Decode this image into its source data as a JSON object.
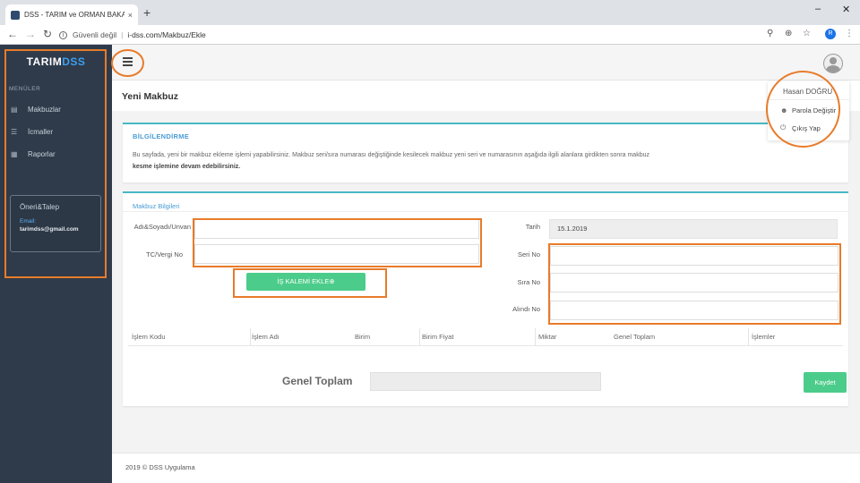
{
  "browser": {
    "tab_title": "DSS - TARIM ve ORMAN BAKAN",
    "tab_close": "×",
    "new_tab": "+",
    "security_label": "Güvenli değil",
    "url": "i-dss.com/Makbuz/Ekle",
    "profile_initial": "R"
  },
  "sidebar": {
    "brand_part1": "TARIM",
    "brand_part2": "DSS",
    "menu_header": "MENÜLER",
    "items": [
      {
        "label": "Makbuzlar",
        "icon": "receipt-icon"
      },
      {
        "label": "İcmaller",
        "icon": "list-icon"
      },
      {
        "label": "Raporlar",
        "icon": "grid-icon"
      }
    ],
    "feedback": {
      "title": "Öneri&Talep",
      "email_label": "Email:",
      "email": "tarimdss@gmail.com"
    }
  },
  "header": {
    "page_title": "Yeni Makbuz",
    "user_menu": {
      "name": "Hasan DOĞRU",
      "items": [
        {
          "label": "Parola Değiştir",
          "icon": "user-icon"
        },
        {
          "label": "Çıkış Yap",
          "icon": "power-icon"
        }
      ]
    }
  },
  "info": {
    "heading": "BİLGİLENDİRME",
    "text": "Bu sayfada, yeni bir makbuz ekleme işlemi yapabilirsiniz. Makbuz seri/sıra numarası değiştiğinde kesilecek makbuz yeni seri ve numarasının aşağıda ilgili alanlara girdikten sonra makbuz",
    "text_bold": "kesme işlemine devam edebilirsiniz."
  },
  "form": {
    "heading": "Makbuz Bilgileri",
    "labels": {
      "name": "Adı&Soyadı/Unvan",
      "tax_no": "TC/Vergi No",
      "date": "Tarih",
      "serial": "Seri No",
      "order": "Sıra No",
      "received": "Alındı No"
    },
    "values": {
      "name": "",
      "tax_no": "",
      "date": "15.1.2019",
      "serial": "",
      "order": "",
      "received": ""
    },
    "add_item_button": "İŞ KALEMİ EKLE⊕",
    "table_columns": [
      "İşlem Kodu",
      "İşlem Adı",
      "Birim",
      "Birim Fiyat",
      "Miktar",
      "Genel Toplam",
      "İşlemler"
    ],
    "total_label": "Genel Toplam",
    "total_value": "",
    "save_button": "Kaydet"
  },
  "footer": {
    "text": "2019 © DSS Uygulama"
  },
  "colors": {
    "sidebar": "#2f3b4a",
    "accent_blue": "#3c9ff0",
    "green_button": "#4ccc8a",
    "panel_border": "#46b8c4",
    "annotation_orange": "#e87b2a"
  }
}
